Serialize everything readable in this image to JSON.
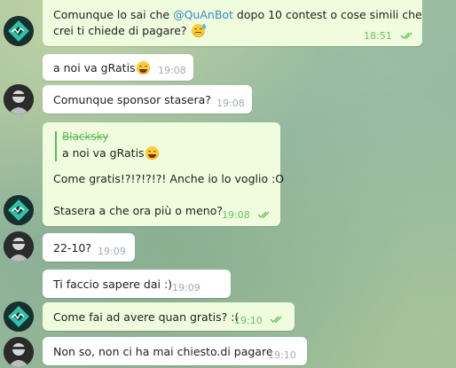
{
  "messages": [
    {
      "text_pre": "Comunque lo sai che ",
      "mention": "@QuAnBot",
      "text_post": " dopo 10 contest o cose simili che",
      "text_line2": "crei ti chiede di pagare?",
      "emoji": "sweat-smile-emoji",
      "time": "18:51",
      "read": true
    },
    {
      "text": "a noi va gRatis",
      "emoji": "laughing-emoji",
      "time": "19:08"
    },
    {
      "text": "Comunque sponsor stasera?",
      "time": "19:08"
    },
    {
      "reply_name": "Blacksky",
      "reply_text": "a noi va gRatis",
      "reply_emoji": "laughing-emoji",
      "line1": "Come gratis!?!?!?!?! Anche io lo voglio :O",
      "line2": "Stasera a che ora più o meno?",
      "time": "19:08",
      "read": true
    },
    {
      "text": "22-10?",
      "time": "19:09"
    },
    {
      "text": "Ti faccio sapere dai :)",
      "time": "19:09"
    },
    {
      "text": "Come fai ad avere quan gratis? :(",
      "time": "19:10",
      "read": true
    },
    {
      "text": "Non so, non ci ha mai chiesto.di pagare",
      "time": "19:10"
    }
  ],
  "colors": {
    "outgoing_bubble": "#effdde",
    "incoming_bubble": "#ffffff",
    "accent_green": "#5fba58",
    "mention_blue": "#3a86c8",
    "timestamp_gray": "#a0acb6"
  },
  "icons": {
    "bot_avatar": "bot-avatar",
    "user_avatar": "user-avatar",
    "read_receipt": "double-check-icon"
  }
}
